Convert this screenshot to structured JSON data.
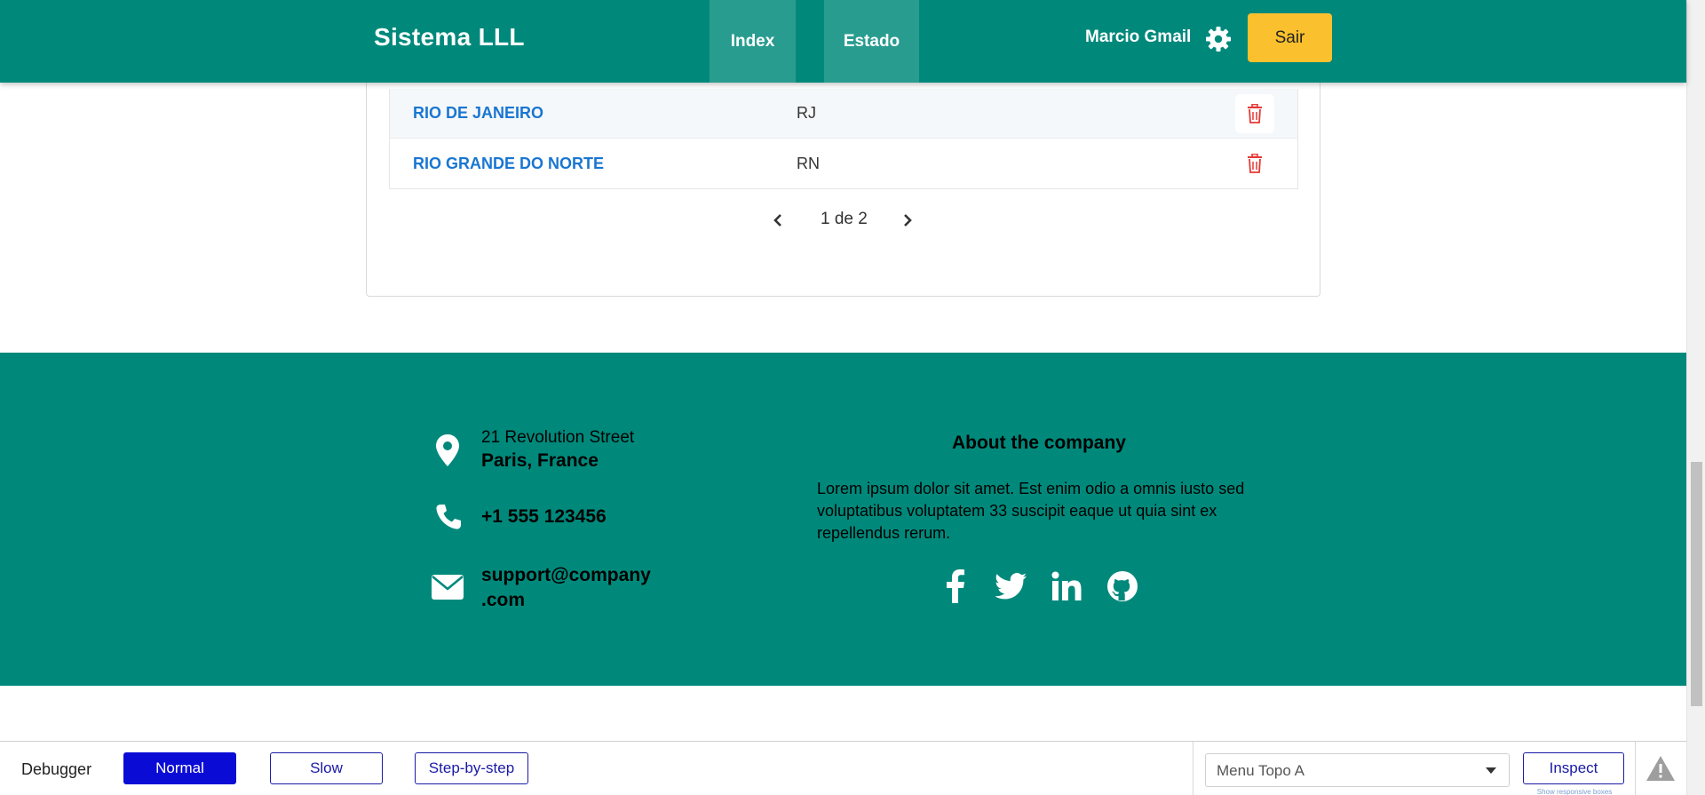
{
  "navbar": {
    "brand": "Sistema LLL",
    "tabs": [
      {
        "label": "Index"
      },
      {
        "label": "Estado"
      }
    ],
    "user_name": "Marcio Gmail",
    "logout_label": "Sair"
  },
  "table": {
    "rows": [
      {
        "name": "RIO DE JANEIRO",
        "uf": "RJ"
      },
      {
        "name": "RIO GRANDE DO NORTE",
        "uf": "RN"
      }
    ]
  },
  "pagination": {
    "text": "1 de 2"
  },
  "footer": {
    "address_line1": "21 Revolution Street",
    "address_line2": "Paris, France",
    "phone": "+1 555 123456",
    "email_line1": "support@company",
    "email_line2": ".com",
    "about_title": "About the company",
    "about_text": "Lorem ipsum dolor sit amet. Est enim odio a omnis iusto sed voluptatibus voluptatem 33 suscipit eaque ut quia sint ex repellendus rerum.",
    "social": [
      "facebook-icon",
      "twitter-icon",
      "linkedin-icon",
      "github-icon"
    ]
  },
  "debugger": {
    "label": "Debugger",
    "modes": [
      {
        "label": "Normal",
        "active": true
      },
      {
        "label": "Slow",
        "active": false
      },
      {
        "label": "Step-by-step",
        "active": false
      }
    ],
    "select_value": "Menu Topo A",
    "inspect_label": "Inspect",
    "inspect_hint": "Show responsive boxes"
  },
  "colors": {
    "primary": "#00897b",
    "accent": "#fbc02d",
    "link": "#1976d2",
    "danger": "#e53935",
    "debug_active": "#0b0bd6"
  }
}
